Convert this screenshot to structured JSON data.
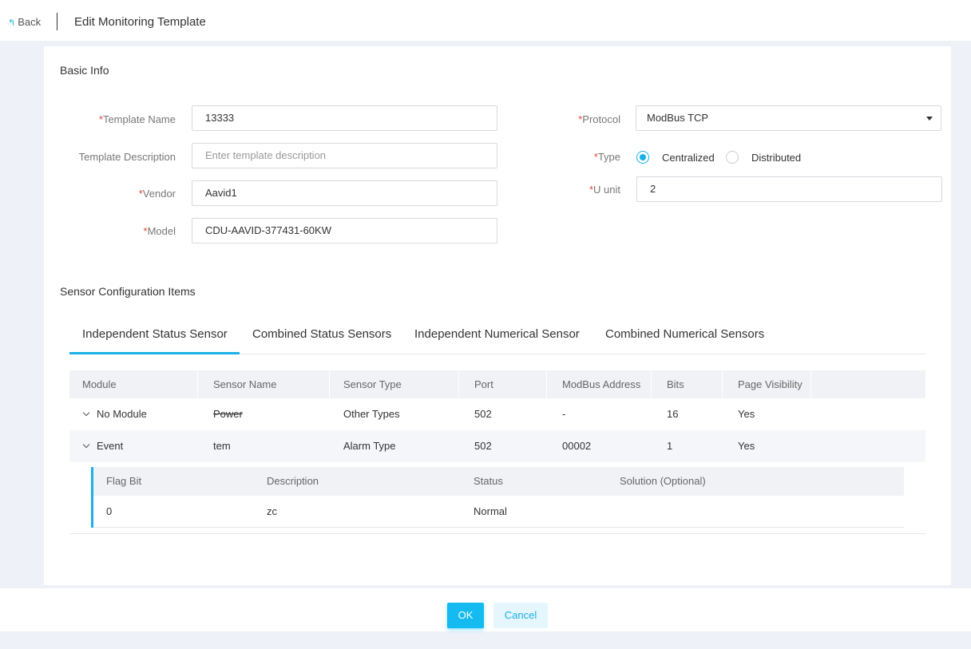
{
  "header": {
    "back_label": "Back",
    "back_icon": "back-arrow-icon",
    "title": "Edit Monitoring Template"
  },
  "basic_info": {
    "section_title": "Basic Info",
    "template_name": {
      "label": "Template Name",
      "value": "13333"
    },
    "template_description": {
      "label": "Template Description",
      "placeholder": "Enter template description"
    },
    "vendor": {
      "label": "Vendor",
      "value": "Aavid1"
    },
    "model": {
      "label": "Model",
      "value": "CDU-AAVID-377431-60KW"
    },
    "protocol": {
      "label": "Protocol",
      "value": "ModBus TCP"
    },
    "type": {
      "label": "Type",
      "options": [
        "Centralized",
        "Distributed"
      ],
      "selected": "Centralized"
    },
    "u_unit": {
      "label": "U unit",
      "value": "2"
    },
    "required_mark": "*"
  },
  "sensor_config": {
    "section_title": "Sensor Configuration Items",
    "tabs": [
      {
        "label": "Independent Status Sensor",
        "active": true
      },
      {
        "label": "Combined Status Sensors",
        "active": false
      },
      {
        "label": "Independent Numerical Sensor",
        "active": false
      },
      {
        "label": "Combined Numerical Sensors",
        "active": false
      }
    ],
    "table": {
      "headers": [
        "Module",
        "Sensor Name",
        "Sensor Type",
        "Port",
        "ModBus Address",
        "Bits",
        "Page Visibility"
      ],
      "rows": [
        {
          "module": "No Module",
          "sensor_name": "Power",
          "sensor_type": "Other Types",
          "port": "502",
          "modbus_address": "-",
          "bits": "16",
          "page_visibility": "Yes",
          "expanded": false
        },
        {
          "module": "Event",
          "sensor_name": "tem",
          "sensor_type": "Alarm Type",
          "port": "502",
          "modbus_address": "00002",
          "bits": "1",
          "page_visibility": "Yes",
          "expanded": true
        }
      ],
      "sub_table": {
        "headers": [
          "Flag Bit",
          "Description",
          "Status",
          "Solution (Optional)"
        ],
        "rows": [
          {
            "flag_bit": "0",
            "description": "zc",
            "status": "Normal",
            "solution": ""
          }
        ]
      }
    }
  },
  "footer": {
    "ok_label": "OK",
    "cancel_label": "Cancel"
  },
  "colors": {
    "accent": "#1ab0e8",
    "required": "#e0453a",
    "page_bg": "#eef1f8"
  }
}
